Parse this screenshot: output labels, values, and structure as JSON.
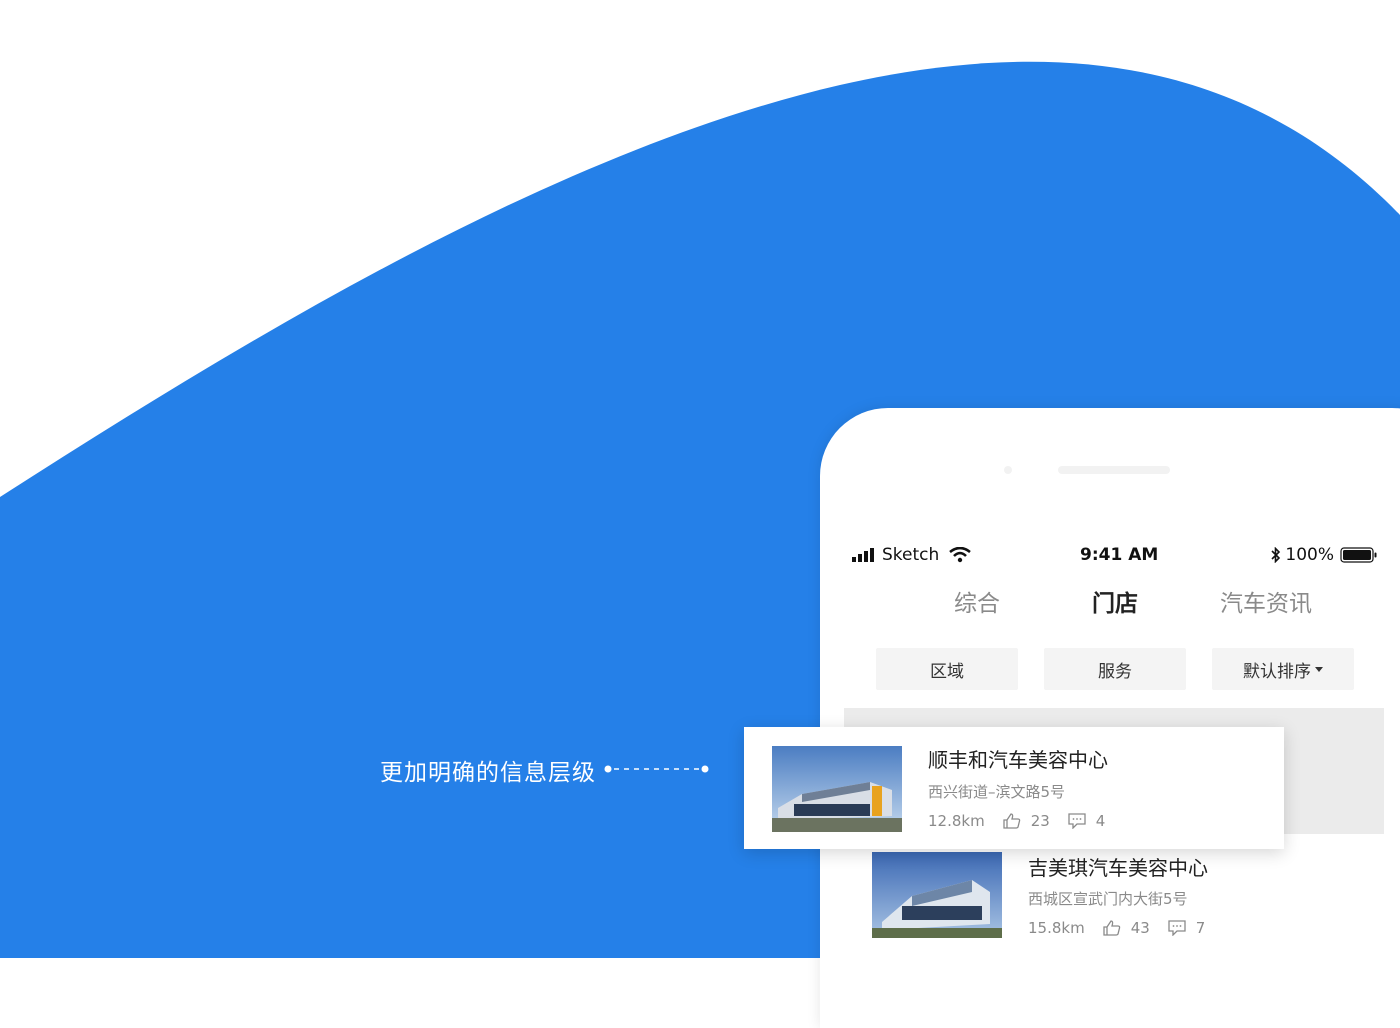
{
  "callout": {
    "text": "更加明确的信息层级"
  },
  "status_bar": {
    "carrier": "Sketch",
    "time": "9:41 AM",
    "battery": "100%"
  },
  "tabs": [
    {
      "label": "综合",
      "active": false
    },
    {
      "label": "门店",
      "active": true
    },
    {
      "label": "汽车资讯",
      "active": false
    }
  ],
  "filters": {
    "area": "区域",
    "service": "服务",
    "sort": "默认排序"
  },
  "stores": [
    {
      "name": "顺丰和汽车美容中心",
      "address": "西兴街道–滨文路5号",
      "distance": "12.8km",
      "likes": "23",
      "comments": "4",
      "highlighted": true
    },
    {
      "name": "吉美琪汽车美容中心",
      "address": "西城区宣武门内大街5号",
      "distance": "15.8km",
      "likes": "43",
      "comments": "7",
      "highlighted": false
    }
  ],
  "colors": {
    "brand_blue": "#2580e8",
    "text_primary": "#222222",
    "text_secondary": "#8a8a8a"
  }
}
